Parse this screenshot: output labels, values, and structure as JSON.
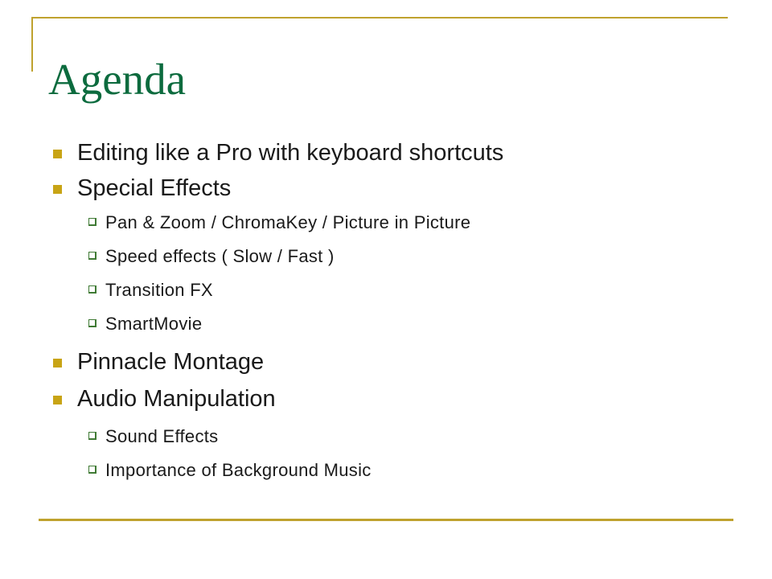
{
  "slide": {
    "title": "Agenda",
    "accent_gold": "#bfa22e",
    "bullet_gold": "#c8a415",
    "bullet_green": "#3f7a34",
    "title_green": "#0c6b3e",
    "body_text_color": "#1a1a1a",
    "background": "#ffffff"
  },
  "content": {
    "items": [
      {
        "level": 1,
        "text": "Editing like a Pro with keyboard shortcuts"
      },
      {
        "level": 1,
        "text": "Special Effects"
      },
      {
        "level": 2,
        "text": "Pan & Zoom / ChromaKey / Picture in Picture"
      },
      {
        "level": 2,
        "text": "Speed effects ( Slow / Fast )"
      },
      {
        "level": 2,
        "text": "Transition FX"
      },
      {
        "level": 2,
        "text": "SmartMovie"
      },
      {
        "level": 1,
        "text": "Pinnacle Montage"
      },
      {
        "level": 1,
        "text": "Audio Manipulation"
      },
      {
        "level": 2,
        "text": "Sound Effects"
      },
      {
        "level": 2,
        "text": "Importance of Background Music"
      }
    ]
  }
}
